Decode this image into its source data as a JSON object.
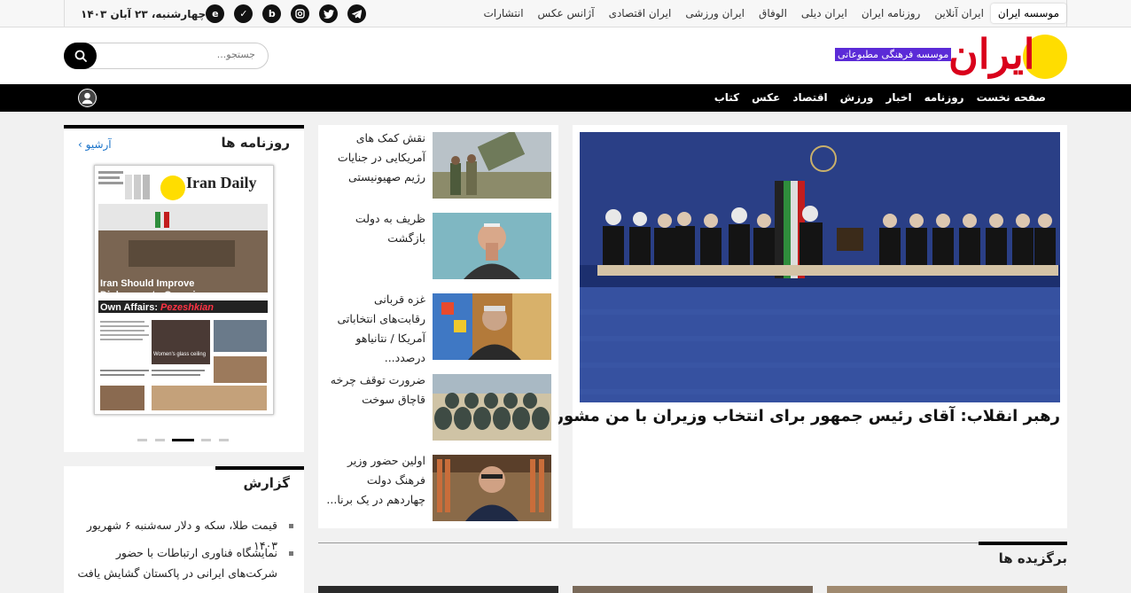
{
  "topbar": {
    "sites": [
      "موسسه ایران",
      "ایران آنلاین",
      "روزنامه ایران",
      "ایران دیلی",
      "الوفاق",
      "ایران ورزشی",
      "ایران اقتصادی",
      "آژانس عکس",
      "انتشارات"
    ],
    "active_site": "موسسه ایران",
    "date": "چهارشنبه، ۲۳ آبان ۱۴۰۳",
    "social": [
      "telegram-icon",
      "twitter-icon",
      "instagram-icon",
      "bale-icon",
      "soroush-icon",
      "eitaa-icon"
    ]
  },
  "header": {
    "logo": "ایران",
    "tagline": "موسسه فرهنگی مطبوعاتی",
    "search_placeholder": "جستجو..."
  },
  "nav": {
    "items": [
      "صفحه نخست",
      "روزنامه",
      "اخبار",
      "ورزش",
      "اقتصاد",
      "عکس",
      "کتاب"
    ]
  },
  "main_story": {
    "title": "رهبر انقلاب: آقای رئیس جمهور برای انتخاب وزیران با من مشورت کردند"
  },
  "news": [
    {
      "title": "نقش کمک های آمریکایی در جنایات رژیم صهیونیستی"
    },
    {
      "title": "ظریف به دولت بازگشت"
    },
    {
      "title": "غزه قربانی رقابت‌های انتخاباتی آمریکا / نتانیاهو درصدد..."
    },
    {
      "title": "ضرورت توقف چرخه قاچاق سوخت"
    },
    {
      "title": "اولین حضور وزیر فرهنگ دولت چهاردهم در یک برنا..."
    }
  ],
  "papers": {
    "title": "روزنامه ها",
    "archive": "آرشیو",
    "paper_name": "Iran Daily",
    "headline": "Iran Should Improve Diplomacy to Organize Own Affairs:",
    "headline_name": "Pezeshkian",
    "slide_count": 5,
    "active_slide": 3
  },
  "reports": {
    "title": "گزارش",
    "items": [
      "قیمت طلا، سکه و دلار سه‌شنبه ۶ شهریور ۱۴۰۳",
      "نمایشگاه فناوری ارتباطات با حضور شرکت‌های ایرانی در پاکستان گشایش یافت"
    ]
  },
  "picks": {
    "title": "برگزیده ها"
  },
  "colors": {
    "brand_red": "#d9001b",
    "logo_yellow": "#ffdd00",
    "nav_black": "#000000",
    "link_blue": "#1a73c9"
  }
}
